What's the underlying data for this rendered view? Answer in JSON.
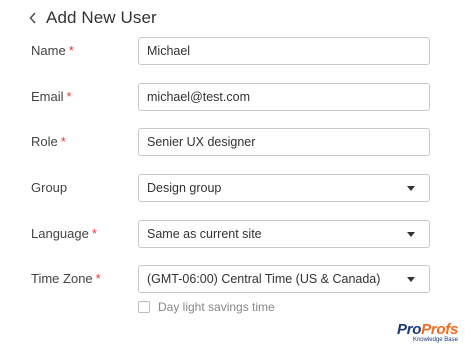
{
  "header": {
    "title": "Add New User",
    "back_icon": "chevron-left-icon"
  },
  "form": {
    "name": {
      "label": "Name",
      "required_mark": "*",
      "value": "Michael"
    },
    "email": {
      "label": "Email",
      "required_mark": "*",
      "value": "michael@test.com"
    },
    "role": {
      "label": "Role",
      "required_mark": "*",
      "value": "Senier UX designer"
    },
    "group": {
      "label": "Group",
      "selected": "Design group"
    },
    "language": {
      "label": "Language",
      "required_mark": "*",
      "selected": "Same as current site"
    },
    "timezone": {
      "label": "Time Zone",
      "required_mark": "*",
      "selected": "(GMT-06:00) Central Time (US & Canada)"
    },
    "daylight": {
      "label": "Day light savings time",
      "checked": false
    }
  },
  "logo": {
    "part1": "Pro",
    "part2": "Profs",
    "sub": "Knowledge Base"
  },
  "colors": {
    "required": "#e53935",
    "border": "#c9c9c9",
    "logo_blue": "#1a3a7a",
    "logo_orange": "#f26b21"
  }
}
